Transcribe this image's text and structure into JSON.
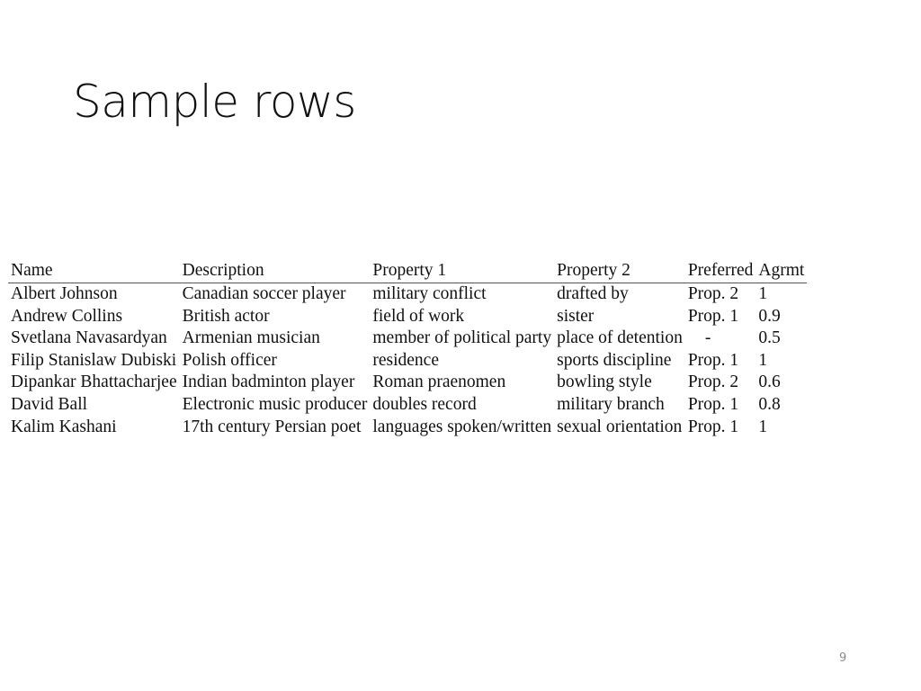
{
  "slide": {
    "title": "Sample rows",
    "page_number": "9"
  },
  "table": {
    "headers": [
      "Name",
      "Description",
      "Property 1",
      "Property 2",
      "Preferred",
      "Agrmt"
    ],
    "rows": [
      [
        "Albert Johnson",
        "Canadian soccer player",
        "military conflict",
        "drafted by",
        "Prop. 2",
        "1"
      ],
      [
        "Andrew Collins",
        "British actor",
        "field of work",
        "sister",
        "Prop. 1",
        "0.9"
      ],
      [
        "Svetlana Navasardyan",
        "Armenian musician",
        "member of political party",
        "place of detention",
        "-",
        "0.5"
      ],
      [
        "Filip Stanislaw Dubiski",
        "Polish officer",
        "residence",
        "sports discipline",
        "Prop. 1",
        "1"
      ],
      [
        "Dipankar Bhattacharjee",
        "Indian badminton player",
        "Roman praenomen",
        "bowling style",
        "Prop. 2",
        "0.6"
      ],
      [
        "David Ball",
        "Electronic music producer",
        "doubles record",
        "military branch",
        "Prop. 1",
        "0.8"
      ],
      [
        "Kalim Kashani",
        "17th century Persian poet",
        "languages spoken/written",
        "sexual orientation",
        "Prop. 1",
        "1"
      ]
    ]
  }
}
